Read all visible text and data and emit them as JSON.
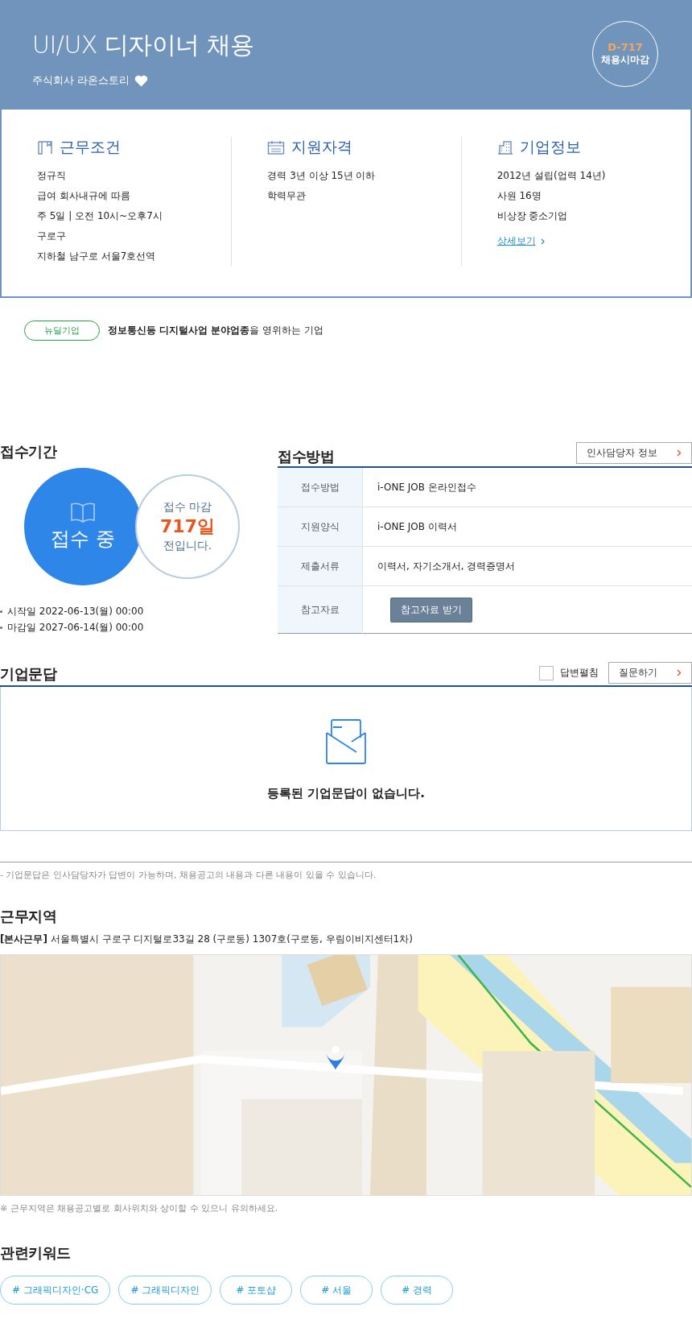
{
  "header": {
    "title": "UI/UX 디자이너 채용",
    "company": "주식회사 라온스토리",
    "dday": "D-717",
    "deadline_label": "채용시마감"
  },
  "conditions": [
    {
      "kind": "book",
      "heading": "근무조건",
      "lines": [
        "정규직",
        "급여 회사내규에 따름",
        "주 5일 | 오전 10시~오후7시",
        "구로구",
        "지하철 남구로 서울7호선역"
      ]
    },
    {
      "kind": "calendar",
      "heading": "지원자격",
      "lines": [
        "경력 3년 이상 15년 이하",
        "학력무관"
      ]
    },
    {
      "kind": "building",
      "heading": "기업정보",
      "lines": [
        "2012년 설립(업력 14년)",
        "사원 16명",
        "비상장 중소기업"
      ],
      "link": "상세보기"
    }
  ],
  "badge": {
    "label": "뉴딜기업",
    "description": "**정보통신등 디지털사업 분야업종**을 영위하는 기업"
  },
  "period": {
    "heading": "접수기간",
    "status": "접수 중",
    "remaining_top": "접수 마감",
    "remaining_days": "717일",
    "remaining_bottom": "전입니다.",
    "dates": [
      "시작일 2022-06-13(월) 00:00",
      "마감일 2027-06-14(월) 00:00"
    ]
  },
  "method": {
    "heading": "접수방법",
    "contact_button": "인사담당자 정보",
    "rows": [
      {
        "kind": "text",
        "label": "접수방법",
        "value": "i-ONE JOB 온라인접수"
      },
      {
        "kind": "text",
        "label": "지원양식",
        "value": "i-ONE JOB 이력서"
      },
      {
        "kind": "text",
        "label": "제출서류",
        "value": "이력서, 자기소개서, 경력증명서"
      },
      {
        "kind": "button",
        "label": "참고자료",
        "value": "참고자료 받기"
      }
    ]
  },
  "qna": {
    "heading": "기업문답",
    "expand_label": "답변펼침",
    "expand_checked": false,
    "ask_button": "질문하기",
    "empty_message": "등록된 기업문답이 없습니다.",
    "note": "- 기업문답은 인사담당자가 답변이 가능하며, 채용공고의 내용과 다른 내용이 있을 수 있습니다."
  },
  "location": {
    "heading": "근무지역",
    "address": "**[본사근무]** 서울특별시 구로구 디지털로33길 28 (구로동) 1307호(구로동, 우림이비지센터1차)",
    "note": "※ 근무지역은 채용공고별로 회사위치와 상이할 수 있으니 유의하세요."
  },
  "keywords": {
    "heading": "관련키워드",
    "tags": [
      "# 그래픽디자인·CG",
      "# 그래픽디자인",
      "# 포토샵",
      "# 서울",
      "# 경력"
    ]
  }
}
